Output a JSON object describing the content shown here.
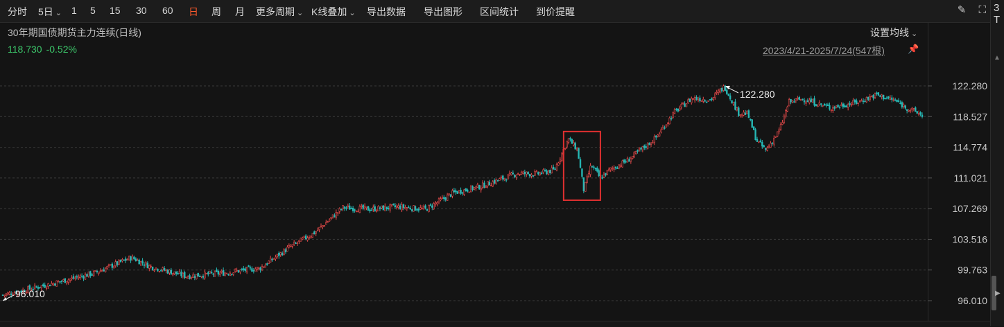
{
  "toolbar": {
    "items": [
      {
        "label": "分时",
        "chevron": false,
        "active": false
      },
      {
        "label": "5日",
        "chevron": true,
        "active": false
      },
      {
        "label": "1",
        "chevron": false,
        "active": false
      },
      {
        "label": "5",
        "chevron": false,
        "active": false
      },
      {
        "label": "15",
        "chevron": false,
        "active": false
      },
      {
        "label": "30",
        "chevron": false,
        "active": false
      },
      {
        "label": "60",
        "chevron": false,
        "active": false
      },
      {
        "label": "日",
        "chevron": false,
        "active": true
      },
      {
        "label": "周",
        "chevron": false,
        "active": false
      },
      {
        "label": "月",
        "chevron": false,
        "active": false
      },
      {
        "label": "更多周期",
        "chevron": true,
        "active": false
      },
      {
        "label": "K线叠加",
        "chevron": true,
        "active": false
      },
      {
        "label": "导出数据",
        "chevron": false,
        "active": false
      },
      {
        "label": "导出图形",
        "chevron": false,
        "active": false
      },
      {
        "label": "区间统计",
        "chevron": false,
        "active": false
      },
      {
        "label": "到价提醒",
        "chevron": false,
        "active": false
      }
    ],
    "tool_icons": [
      "brush-icon",
      "fullscreen-icon"
    ]
  },
  "chart": {
    "title": "30年期国债期货主力连续(日线)",
    "last_price": "118.730",
    "change_pct": "-0.52%",
    "ma_setting_label": "设置均线",
    "range_label": "2023/4/21-2025/7/24(547根)",
    "max_label": "122.280",
    "min_label": "96.010"
  },
  "right_panel": {
    "text": "3\nT"
  },
  "colors": {
    "up": "#e84a4a",
    "down": "#26b8b5",
    "highlight_box": "#e03030",
    "active_tab": "#ff5a2c",
    "change_text": "#3cc66a"
  },
  "chart_data": {
    "type": "candlestick",
    "title": "30年期国债期货主力连续(日线)",
    "y_ticks": [
      122.28,
      118.527,
      114.774,
      111.021,
      107.269,
      103.516,
      99.763,
      96.01
    ],
    "y_tick_labels": [
      "122.280",
      "118.527",
      "114.774",
      "111.021",
      "107.269",
      "103.516",
      "99.763",
      "96.010"
    ],
    "ylim": [
      96.01,
      122.28
    ],
    "bar_count": 547,
    "date_range": [
      "2023/4/21",
      "2025/7/24"
    ],
    "grid": true,
    "annotations": [
      {
        "label": "122.280",
        "type": "high"
      },
      {
        "label": "96.010",
        "type": "low"
      },
      {
        "type": "highlight-box",
        "x_range": [
          0.61,
          0.65
        ],
        "y_range": [
          108.3,
          116.7
        ]
      }
    ],
    "close_path": [
      [
        0.0,
        96.7
      ],
      [
        0.05,
        98.0
      ],
      [
        0.1,
        99.4
      ],
      [
        0.14,
        101.3
      ],
      [
        0.16,
        100.2
      ],
      [
        0.2,
        99.0
      ],
      [
        0.24,
        99.4
      ],
      [
        0.28,
        100.0
      ],
      [
        0.31,
        102.4
      ],
      [
        0.34,
        104.4
      ],
      [
        0.37,
        107.4
      ],
      [
        0.4,
        107.2
      ],
      [
        0.43,
        107.5
      ],
      [
        0.46,
        107.2
      ],
      [
        0.49,
        109.2
      ],
      [
        0.52,
        110.0
      ],
      [
        0.54,
        110.8
      ],
      [
        0.56,
        111.6
      ],
      [
        0.58,
        111.5
      ],
      [
        0.6,
        112.0
      ],
      [
        0.615,
        115.8
      ],
      [
        0.625,
        114.5
      ],
      [
        0.632,
        109.5
      ],
      [
        0.64,
        112.6
      ],
      [
        0.65,
        111.0
      ],
      [
        0.66,
        112.0
      ],
      [
        0.68,
        113.2
      ],
      [
        0.71,
        115.9
      ],
      [
        0.73,
        119.0
      ],
      [
        0.75,
        120.8
      ],
      [
        0.77,
        120.6
      ],
      [
        0.785,
        122.2
      ],
      [
        0.8,
        119.0
      ],
      [
        0.81,
        118.9
      ],
      [
        0.82,
        115.6
      ],
      [
        0.83,
        114.4
      ],
      [
        0.845,
        116.9
      ],
      [
        0.855,
        120.3
      ],
      [
        0.87,
        120.7
      ],
      [
        0.9,
        119.6
      ],
      [
        0.93,
        120.3
      ],
      [
        0.95,
        121.2
      ],
      [
        0.97,
        120.5
      ],
      [
        0.985,
        119.5
      ],
      [
        1.0,
        118.73
      ]
    ]
  }
}
